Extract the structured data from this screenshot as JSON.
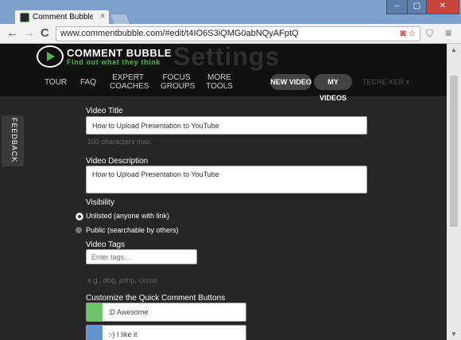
{
  "browser": {
    "tab_title": "Comment Bubble - React",
    "tab_close": "×",
    "window_controls": {
      "minimize": "–",
      "maximize": "▢",
      "close": "✕"
    },
    "url_scheme": "www.commentbubble.com/#edit/t4IO6S3iQMG0abNQyAFptQ",
    "nav": {
      "back": "←",
      "forward": "→",
      "reload": "C"
    },
    "shield_icon": "shield-icon",
    "menu_icon": "≡"
  },
  "site": {
    "background_title": "Settings",
    "logo_name": "COMMENT BUBBLE",
    "logo_tagline": "Find out what they think",
    "nav_items": [
      "TOUR",
      "FAQ",
      "EXPERT COACHES",
      "FOCUS GROUPS",
      "MORE TOOLS"
    ],
    "new_video": "NEW VIDEO",
    "my_videos": "MY VIDEOS",
    "user_menu": "TECHE KER ▾",
    "feedback": "FEEDBACK"
  },
  "form": {
    "title_label": "Video Title",
    "title_value": "How to Upload Presentation to YouTube",
    "title_hint": "100 characters max.",
    "description_label": "Video Description",
    "description_value": "How to Upload Presentation to YouTube",
    "visibility_label": "Visibility",
    "visibility_options": [
      "Unlisted (anyone with link)",
      "Public (searchable by others)"
    ],
    "visibility_selected": "Unlisted (anyone with link)",
    "tags_label": "Video Tags",
    "tags_placeholder": "Enter tags...",
    "tags_hint": "e.g., dog, jump, circus",
    "quick_label": "Customize the Quick Comment Buttons",
    "quick_buttons": [
      {
        "text": ":D Awesome",
        "color": "#6cc36a"
      },
      {
        "text": ":-) I like it",
        "color": "#5f94d0"
      }
    ]
  },
  "colors": {
    "accent_green": "#4db848",
    "page_bg": "#262626",
    "header_bg": "#111111"
  }
}
